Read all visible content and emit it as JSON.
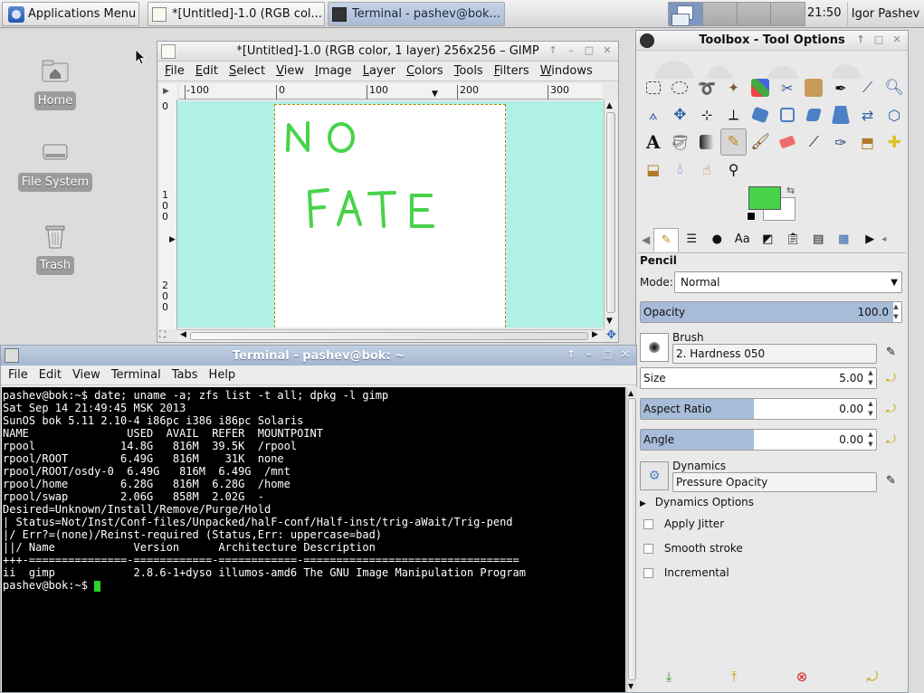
{
  "panel": {
    "app_menu_label": "Applications Menu",
    "tasks": [
      {
        "label": "*[Untitled]-1.0 (RGB col..."
      },
      {
        "label": "Terminal - pashev@bok..."
      }
    ],
    "clock": "21:50",
    "user": "Igor Pashev"
  },
  "desktop": {
    "icons": [
      {
        "label": "Home"
      },
      {
        "label": "File System"
      },
      {
        "label": "Trash"
      }
    ]
  },
  "gimp": {
    "title": "*[Untitled]-1.0 (RGB color, 1 layer) 256x256 – GIMP",
    "menu": [
      "File",
      "Edit",
      "Select",
      "View",
      "Image",
      "Layer",
      "Colors",
      "Tools",
      "Filters",
      "Windows"
    ],
    "hruler_labels": [
      "-100",
      "0",
      "100",
      "200",
      "300"
    ],
    "vruler_labels": [
      "0",
      "1\n0\n0",
      "2\n0\n0"
    ],
    "canvas_text": [
      "NO",
      "FATE"
    ],
    "colors": {
      "canvas_bg": "#b1f0e5",
      "stroke": "#47d34a"
    }
  },
  "toolbox": {
    "title": "Toolbox - Tool Options",
    "fg_color": "#47d34a",
    "bg_color": "#ffffff",
    "tool_options": {
      "tool_name": "Pencil",
      "mode_label": "Mode:",
      "mode_value": "Normal",
      "opacity_label": "Opacity",
      "opacity_value": "100.0",
      "brush_label": "Brush",
      "brush_value": "2. Hardness 050",
      "size_label": "Size",
      "size_value": "5.00",
      "aspect_label": "Aspect Ratio",
      "aspect_value": "0.00",
      "angle_label": "Angle",
      "angle_value": "0.00",
      "dynamics_label": "Dynamics",
      "dynamics_value": "Pressure Opacity",
      "dynamics_options_label": "Dynamics Options",
      "apply_jitter_label": "Apply Jitter",
      "smooth_stroke_label": "Smooth stroke",
      "incremental_label": "Incremental"
    }
  },
  "terminal": {
    "title": "Terminal - pashev@bok: ~",
    "menu": [
      "File",
      "Edit",
      "View",
      "Terminal",
      "Tabs",
      "Help"
    ],
    "lines": [
      "pashev@bok:~$ date; uname -a; zfs list -t all; dpkg -l gimp",
      "Sat Sep 14 21:49:45 MSK 2013",
      "SunOS bok 5.11 2.10-4 i86pc i386 i86pc Solaris",
      "NAME               USED  AVAIL  REFER  MOUNTPOINT",
      "rpool             14.8G   816M  39.5K  /rpool",
      "rpool/ROOT        6.49G   816M    31K  none",
      "rpool/ROOT/osdy-0  6.49G   816M  6.49G  /mnt",
      "rpool/home        6.28G   816M  6.28G  /home",
      "rpool/swap        2.06G   858M  2.02G  -",
      "Desired=Unknown/Install/Remove/Purge/Hold",
      "| Status=Not/Inst/Conf-files/Unpacked/halF-conf/Half-inst/trig-aWait/Trig-pend",
      "|/ Err?=(none)/Reinst-required (Status,Err: uppercase=bad)",
      "||/ Name            Version      Architecture Description",
      "+++-===============-============-============-=================================",
      "ii  gimp            2.8.6-1+dyso illumos-amd6 The GNU Image Manipulation Program"
    ],
    "prompt": "pashev@bok:~$ "
  }
}
